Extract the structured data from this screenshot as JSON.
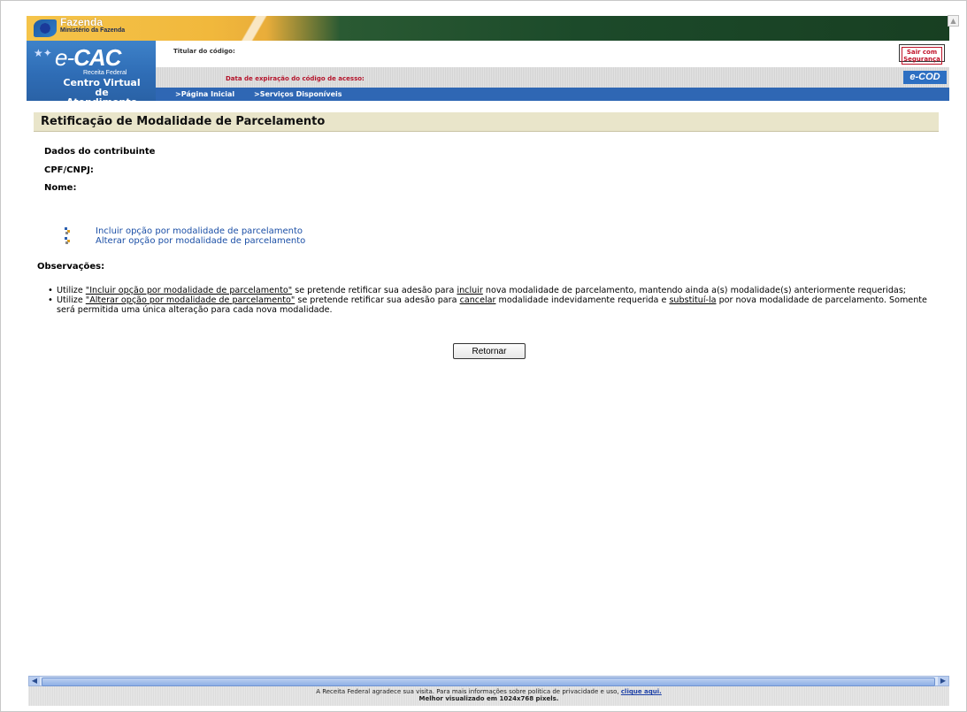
{
  "header": {
    "fazenda_title": "Fazenda",
    "fazenda_subtitle": "Ministério da Fazenda",
    "logo_e": "e-",
    "logo_cac": "CAC",
    "receita_federal": "Receita Federal",
    "centro_virtual": "Centro Virtual",
    "de_atendimento": "de Atendimento",
    "titular_label": "Titular do código:",
    "expiracao_label": "Data de expiração do código de acesso:",
    "sair_line1": "Sair com",
    "sair_line2": "Segurança",
    "ecod_label": "e-COD"
  },
  "nav": {
    "home": ">Página Inicial",
    "services": ">Serviços Disponíveis"
  },
  "page": {
    "title": "Retificação de Modalidade de Parcelamento",
    "dados_label": "Dados do contribuinte",
    "cpf_label": "CPF/CNPJ:",
    "nome_label": "Nome:",
    "options": [
      "Incluir opção por modalidade de parcelamento",
      "Alterar opção por modalidade de parcelamento"
    ],
    "observacoes_label": "Observações:",
    "obs1": {
      "prefix": "Utilize ",
      "link": "\"Incluir opção por modalidade de parcelamento\"",
      "mid": " se pretende retificar sua adesão para ",
      "u": "incluir",
      "suffix": " nova modalidade de parcelamento, mantendo ainda a(s) modalidade(s) anteriormente requeridas;"
    },
    "obs2": {
      "prefix": "Utilize ",
      "link": "\"Alterar opção por modalidade de parcelamento\"",
      "mid": " se pretende retificar sua adesão para ",
      "u1": "cancelar",
      "mid2": " modalidade indevidamente requerida e ",
      "u2": "substituí-la",
      "suffix": " por nova modalidade de parcelamento. Somente será permitida uma única alteração para cada nova modalidade."
    },
    "retornar_button": "Retornar"
  },
  "footer": {
    "text": "A Receita Federal agradece sua visita. Para mais informações sobre política de privacidade e uso, ",
    "link": "clique aqui.",
    "resolution": "Melhor visualizado em 1024x768 pixels."
  },
  "colors": {
    "nav_blue": "#2f67b4",
    "title_bar": "#e9e5ca",
    "expiration_red": "#b5142b",
    "link_blue": "#1b4fa6"
  }
}
